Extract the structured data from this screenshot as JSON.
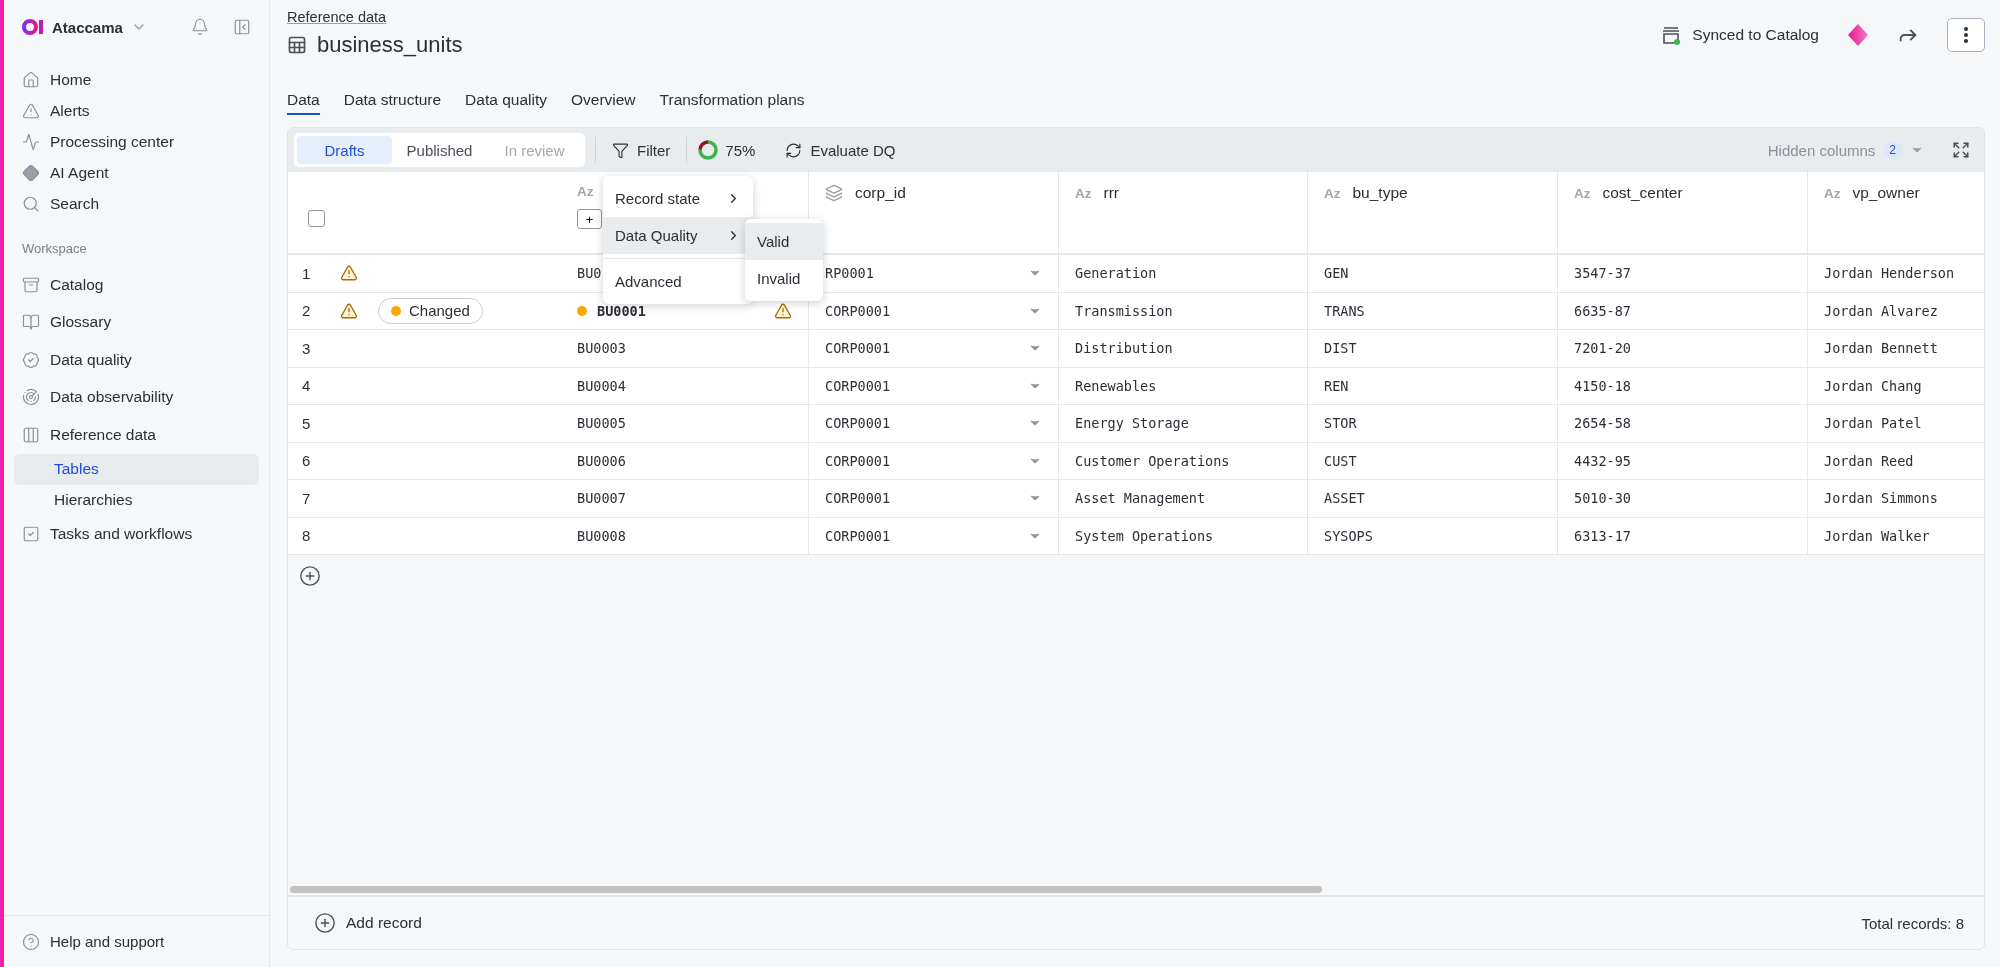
{
  "sidebar": {
    "brand": "Ataccama",
    "nav": [
      {
        "label": "Home",
        "selected": false
      },
      {
        "label": "Alerts",
        "selected": false
      },
      {
        "label": "Processing center",
        "selected": false
      },
      {
        "label": "AI Agent",
        "selected": false
      },
      {
        "label": "Search",
        "selected": false
      }
    ],
    "section_label": "Workspace",
    "workspace": [
      {
        "label": "Catalog",
        "selected": false
      },
      {
        "label": "Glossary",
        "selected": false
      },
      {
        "label": "Data quality",
        "selected": false
      },
      {
        "label": "Data observability",
        "selected": false
      },
      {
        "label": "Reference data",
        "selected": false,
        "children": [
          {
            "label": "Tables",
            "selected": true
          },
          {
            "label": "Hierarchies",
            "selected": false
          }
        ]
      },
      {
        "label": "Tasks and workflows",
        "selected": false
      }
    ],
    "help": "Help and support"
  },
  "header": {
    "breadcrumb": "Reference data",
    "title": "business_units",
    "sync_status": "Synced to Catalog"
  },
  "tabs": [
    {
      "label": "Data",
      "selected": true
    },
    {
      "label": "Data structure",
      "selected": false
    },
    {
      "label": "Data quality",
      "selected": false
    },
    {
      "label": "Overview",
      "selected": false
    },
    {
      "label": "Transformation plans",
      "selected": false
    }
  ],
  "toolbar": {
    "segments": [
      {
        "label": "Drafts",
        "selected": true,
        "disabled": false
      },
      {
        "label": "Published",
        "selected": false,
        "disabled": false
      },
      {
        "label": "In review",
        "selected": false,
        "disabled": true
      }
    ],
    "filter": "Filter",
    "dq": {
      "reading": "75%",
      "level": 0.75
    },
    "evaluate": "Evaluate DQ",
    "hidden_columns": "Hidden columns",
    "hidden_count": "2"
  },
  "table": {
    "add_column": "+",
    "select_all_checked": false,
    "columns": [
      {
        "type_label": "Az",
        "kind": "text"
      },
      {
        "name": "corp_id",
        "kind": "lookup"
      },
      {
        "type_label": "Az",
        "name": "rrr",
        "kind": "text"
      },
      {
        "type_label": "Az",
        "name": "bu_type",
        "kind": "text"
      },
      {
        "type_label": "Az",
        "name": "cost_center",
        "kind": "text"
      },
      {
        "type_label": "Az",
        "name": "vp_owner",
        "kind": "text"
      }
    ],
    "rows": [
      {
        "number": "1",
        "warning": true,
        "cells": [
          "BU0",
          "RP0001",
          "Generation",
          "GEN",
          "3547-37",
          "Jordan Henderson"
        ]
      },
      {
        "number": "2",
        "warning": true,
        "status": "Changed",
        "changed": true,
        "id_warning": true,
        "cells": [
          "BU0001",
          "CORP0001",
          "Transmission",
          "TRANS",
          "6635-87",
          "Jordan Alvarez"
        ]
      },
      {
        "number": "3",
        "warning": false,
        "cells": [
          "BU0003",
          "CORP0001",
          "Distribution",
          "DIST",
          "7201-20",
          "Jordan Bennett"
        ]
      },
      {
        "number": "4",
        "warning": false,
        "cells": [
          "BU0004",
          "CORP0001",
          "Renewables",
          "REN",
          "4150-18",
          "Jordan Chang"
        ]
      },
      {
        "number": "5",
        "warning": false,
        "cells": [
          "BU0005",
          "CORP0001",
          "Energy Storage",
          "STOR",
          "2654-58",
          "Jordan Patel"
        ]
      },
      {
        "number": "6",
        "warning": false,
        "cells": [
          "BU0006",
          "CORP0001",
          "Customer Operations",
          "CUST",
          "4432-95",
          "Jordan Reed"
        ]
      },
      {
        "number": "7",
        "warning": false,
        "cells": [
          "BU0007",
          "CORP0001",
          "Asset Management",
          "ASSET",
          "5010-30",
          "Jordan Simmons"
        ]
      },
      {
        "number": "8",
        "warning": false,
        "cells": [
          "BU0008",
          "CORP0001",
          "System Operations",
          "SYSOPS",
          "6313-17",
          "Jordan Walker"
        ]
      }
    ],
    "add_record": "Add record",
    "total": "Total records: 8"
  },
  "filter_menu": {
    "items": [
      {
        "label": "Record state",
        "selected": false
      },
      {
        "label": "Data Quality",
        "selected": true
      },
      {
        "label": "Advanced",
        "selected": false
      }
    ],
    "submenu": [
      {
        "label": "Valid",
        "selected": true
      },
      {
        "label": "Invalid",
        "selected": false
      }
    ]
  }
}
